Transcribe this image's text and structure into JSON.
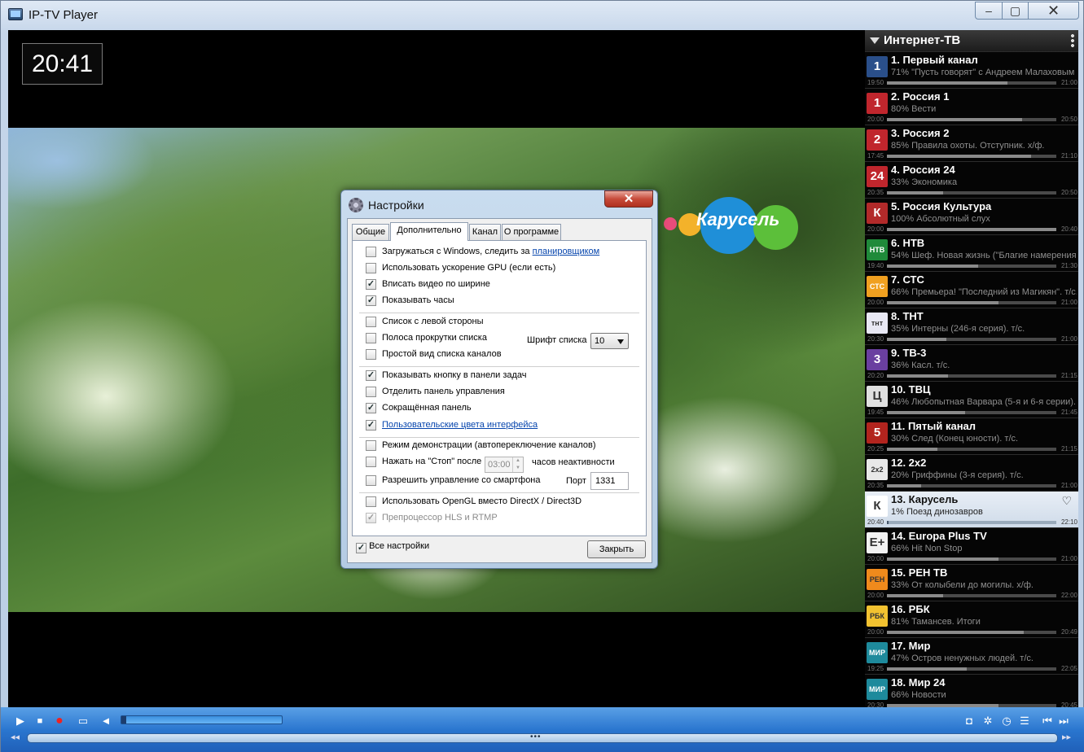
{
  "window": {
    "title": "IP-TV Player",
    "min_label": "▭",
    "max_label": "▢",
    "close_label": "✕"
  },
  "clock": "20:41",
  "video": {
    "channel_logo_text": "Карусель"
  },
  "sidebar": {
    "title": "Интернет-ТВ",
    "channels": [
      {
        "name": "1. Первый канал",
        "program": "71% \"Пусть говорят\" с Андреем Малаховым",
        "start": "19:50",
        "end": "21:00",
        "progress": 0.71,
        "icon_text": "1",
        "icon_color": "#2a4f8a"
      },
      {
        "name": "2. Россия 1",
        "program": "80% Вести",
        "start": "20:00",
        "end": "20:50",
        "progress": 0.8,
        "icon_text": "1",
        "icon_color": "#c0262d"
      },
      {
        "name": "3. Россия 2",
        "program": "85% Правила охоты. Отступник. х/ф.",
        "start": "17:45",
        "end": "21:10",
        "progress": 0.85,
        "icon_text": "2",
        "icon_color": "#c0262d"
      },
      {
        "name": "4. Россия 24",
        "program": "33% Экономика",
        "start": "20:35",
        "end": "20:50",
        "progress": 0.33,
        "icon_text": "24",
        "icon_color": "#c0262d"
      },
      {
        "name": "5. Россия Культура",
        "program": "100% Абсолютный слух",
        "start": "20:00",
        "end": "20:40",
        "progress": 1.0,
        "icon_text": "К",
        "icon_color": "#b22a2a"
      },
      {
        "name": "6. НТВ",
        "program": "54% Шеф. Новая жизнь (\"Благие намерения\"...",
        "start": "19:40",
        "end": "21:30",
        "progress": 0.54,
        "icon_text": "НТВ",
        "icon_color": "#1f8a3a"
      },
      {
        "name": "7. СТС",
        "program": "66% Премьера! \"Последний из Магикян\". т/с.",
        "start": "20:00",
        "end": "21:00",
        "progress": 0.66,
        "icon_text": "СТС",
        "icon_color": "#f0a020"
      },
      {
        "name": "8. ТНТ",
        "program": "35% Интерны (246-я серия). т/с.",
        "start": "20:30",
        "end": "21:00",
        "progress": 0.35,
        "icon_text": "тнт",
        "icon_color": "#e8e8f4"
      },
      {
        "name": "9. ТВ-3",
        "program": "36% Касл. т/с.",
        "start": "20:20",
        "end": "21:15",
        "progress": 0.36,
        "icon_text": "3",
        "icon_color": "#6a3fa0"
      },
      {
        "name": "10. ТВЦ",
        "program": "46% Любопытная Варвара (5-я и 6-я серии). т/с.",
        "start": "19:45",
        "end": "21:45",
        "progress": 0.46,
        "icon_text": "Ц",
        "icon_color": "#e0e0e0"
      },
      {
        "name": "11. Пятый канал",
        "program": "30% След (Конец юности). т/с.",
        "start": "20:25",
        "end": "21:15",
        "progress": 0.3,
        "icon_text": "5",
        "icon_color": "#b2241e"
      },
      {
        "name": "12. 2x2",
        "program": "20% Гриффины (3-я серия). т/с.",
        "start": "20:35",
        "end": "21:00",
        "progress": 0.2,
        "icon_text": "2x2",
        "icon_color": "#e8e8e8"
      },
      {
        "name": "13. Карусель",
        "program": "1% Поезд динозавров",
        "start": "20:40",
        "end": "22:10",
        "progress": 0.01,
        "icon_text": "К",
        "icon_color": "#ffffff",
        "selected": true
      },
      {
        "name": "14. Europa Plus TV",
        "program": "66% Hit Non Stop",
        "start": "20:00",
        "end": "21:00",
        "progress": 0.66,
        "icon_text": "E+",
        "icon_color": "#f2f2f2"
      },
      {
        "name": "15. РЕН ТВ",
        "program": "33% От колыбели до могилы. х/ф.",
        "start": "20:00",
        "end": "22:00",
        "progress": 0.33,
        "icon_text": "РЕН",
        "icon_color": "#f08a1c"
      },
      {
        "name": "16. РБК",
        "program": "81% Тамансев. Итоги",
        "start": "20:00",
        "end": "20:49",
        "progress": 0.81,
        "icon_text": "РБК",
        "icon_color": "#f2c230"
      },
      {
        "name": "17. Мир",
        "program": "47% Остров ненужных людей. т/с.",
        "start": "19:25",
        "end": "22:05",
        "progress": 0.47,
        "icon_text": "МИР",
        "icon_color": "#1e8a9c"
      },
      {
        "name": "18. Мир 24",
        "program": "66% Новости",
        "start": "20:30",
        "end": "20:45",
        "progress": 0.66,
        "icon_text": "МИР",
        "icon_color": "#1e8a9c"
      }
    ]
  },
  "dialog": {
    "title": "Настройки",
    "close_label": "✕",
    "tabs": [
      "Общие",
      "Дополнительно",
      "Канал",
      "О программе"
    ],
    "active_tab": "Дополнительно",
    "opt_autostart": "Загружаться с Windows, следить за",
    "opt_autostart_link": "планировщиком",
    "opt_gpu": "Использовать ускорение GPU (если есть)",
    "opt_fit": "Вписать видео по ширине",
    "opt_clock": "Показывать часы",
    "opt_left": "Список с левой стороны",
    "opt_scroll": "Полоса прокрутки списка",
    "opt_simple": "Простой вид списка каналов",
    "font_label": "Шрифт списка",
    "font_value": "10",
    "opt_taskbar": "Показывать кнопку в панели задач",
    "opt_detach": "Отделить панель управления",
    "opt_short": "Сокращённая панель",
    "opt_colors": "Пользовательские цвета интерфейса",
    "opt_demo": "Режим демонстрации (автопереключение каналов)",
    "opt_stop": "Нажать на \"Стоп\" после",
    "stop_hours": "03:00",
    "stop_suffix": "часов неактивности",
    "opt_phone": "Разрешить управление со смартфона",
    "port_label": "Порт",
    "port_value": "1331",
    "opt_opengl": "Использовать OpenGL вместо DirectX / Direct3D",
    "opt_hls": "Препроцессор HLS и RTMP",
    "all_settings": "Все настройки",
    "close_button": "Закрыть"
  },
  "controls": {
    "play": "▶",
    "stop": "■",
    "record": "●",
    "open": "▭",
    "volume": "◄",
    "seek_left": "◂◂",
    "seek_right": "▸▸",
    "seek_grip": "•••",
    "prev": "⏮",
    "next": "⏭",
    "volume_level": 0.03
  }
}
